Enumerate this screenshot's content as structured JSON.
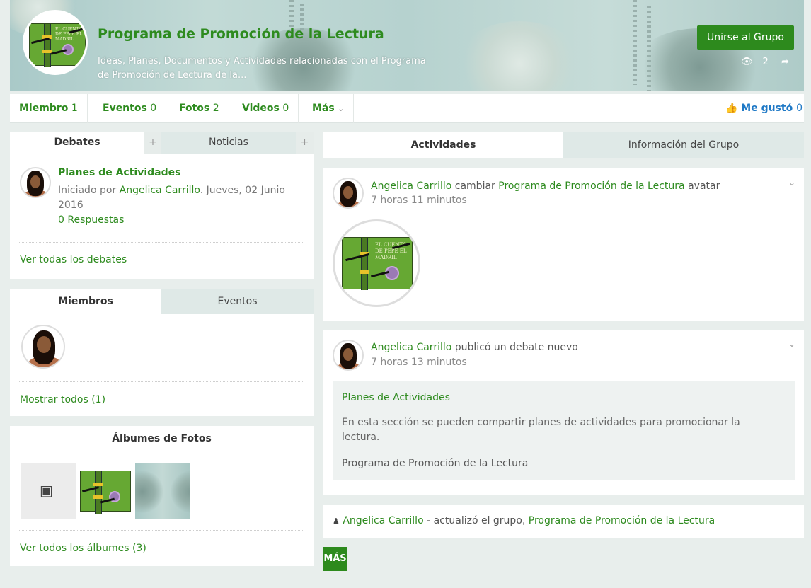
{
  "group": {
    "title": "Programa de Promoción de la Lectura",
    "description": "Ideas, Planes, Documentos y Actividades relacionadas con el Programa de Promoción de Lectura de la...",
    "join_label": "Unirse al Grupo",
    "views": "2",
    "book_cover_text": "EL CUENTO DE PEPE EL MADRIL"
  },
  "nav": {
    "items": [
      {
        "label": "Miembro",
        "count": "1"
      },
      {
        "label": "Eventos",
        "count": "0"
      },
      {
        "label": "Fotos",
        "count": "2"
      },
      {
        "label": "Videos",
        "count": "0"
      },
      {
        "label": "Más",
        "count": "⌄"
      }
    ],
    "like_label": "Me gustó",
    "like_count": "0"
  },
  "debates": {
    "tab_debates": "Debates",
    "tab_noticias": "Noticias",
    "plus": "+",
    "item_title": "Planes de Actividades",
    "started_prefix": "Iniciado por",
    "author": "Angelica Carrillo",
    "date": ". Jueves, 02 Junio 2016",
    "replies": "0 Respuestas",
    "view_all": "Ver todas los debates"
  },
  "members": {
    "tab_members": "Miembros",
    "tab_events": "Eventos",
    "show_all": "Mostrar todos (1)"
  },
  "albums": {
    "title": "Álbumes de Fotos",
    "view_all": "Ver todos los álbumes (3)"
  },
  "activity": {
    "tab_activities": "Actividades",
    "tab_info": "Información del Grupo",
    "feed": [
      {
        "user": "Angelica Carrillo",
        "action": "cambiar",
        "target": "Programa de Promoción de la Lectura",
        "suffix": "avatar",
        "time": "7 horas 11 minutos"
      },
      {
        "user": "Angelica Carrillo",
        "action": "publicó un debate nuevo",
        "time": "7 horas 13 minutos",
        "quote_title": "Planes de Actividades",
        "quote_body": "En esta sección se pueden compartir planes de actividades para promocionar la lectura.",
        "quote_group": "Programa de Promoción de la Lectura"
      }
    ],
    "update_user": "Angelica Carrillo",
    "update_text": "- actualizó el grupo,",
    "update_group": "Programa de Promoción de la Lectura",
    "more_label": "MÁS"
  }
}
